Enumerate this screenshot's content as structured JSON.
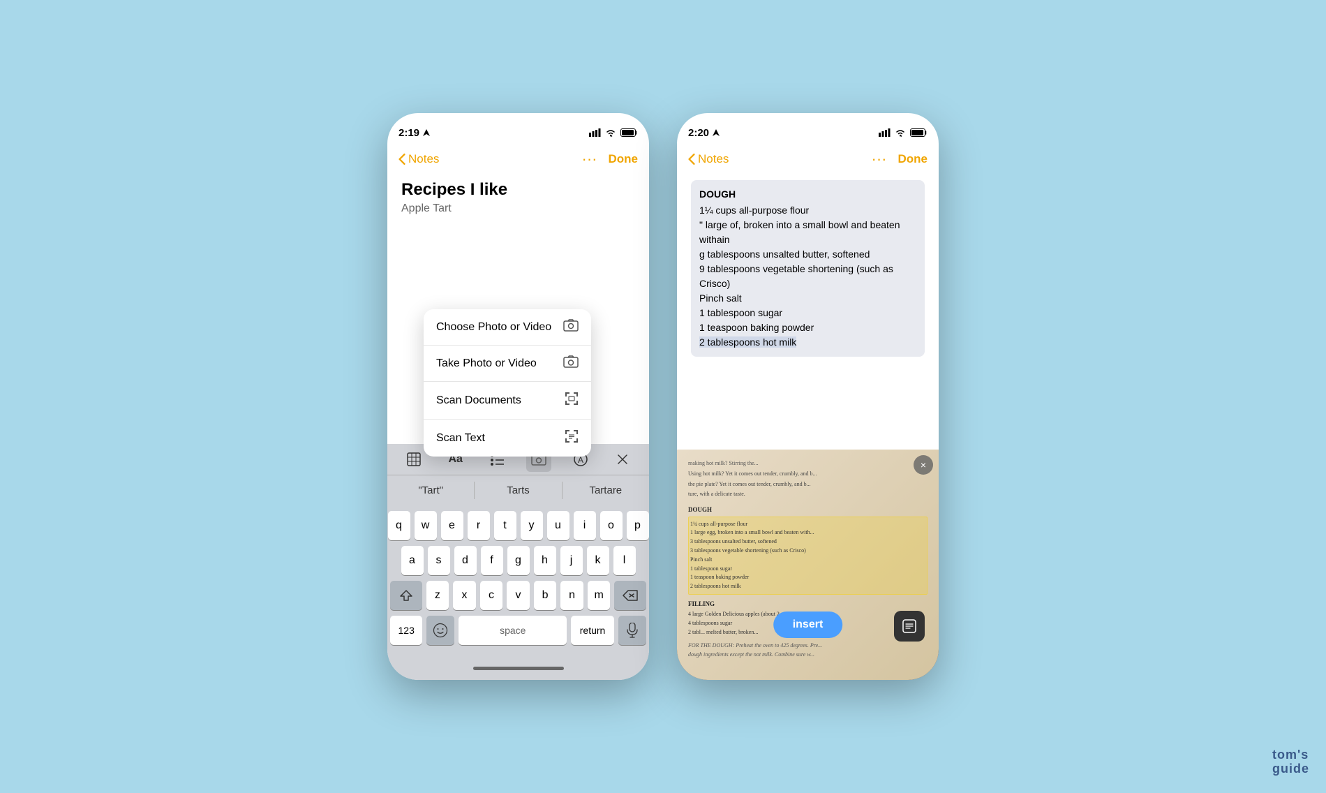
{
  "left_phone": {
    "status_bar": {
      "time": "2:19",
      "signal_bars": "●●●●",
      "wifi": "wifi",
      "battery": "battery"
    },
    "nav": {
      "back_label": "Notes",
      "more_label": "···",
      "done_label": "Done"
    },
    "note": {
      "title": "Recipes I like",
      "subtitle": "Apple Tart"
    },
    "popup_menu": {
      "items": [
        {
          "label": "Choose Photo or Video",
          "icon": "photo"
        },
        {
          "label": "Take Photo or Video",
          "icon": "camera"
        },
        {
          "label": "Scan Documents",
          "icon": "scan-doc"
        },
        {
          "label": "Scan Text",
          "icon": "scan-text"
        }
      ]
    },
    "toolbar": {
      "items": [
        "table",
        "Aa",
        "list",
        "camera",
        "circle-a",
        "close"
      ]
    },
    "autocomplete": {
      "items": [
        "\"Tart\"",
        "Tarts",
        "Tartare"
      ]
    },
    "keyboard": {
      "row1": [
        "q",
        "w",
        "e",
        "r",
        "t",
        "y",
        "u",
        "i",
        "o",
        "p"
      ],
      "row2": [
        "a",
        "s",
        "d",
        "f",
        "g",
        "h",
        "j",
        "k",
        "l"
      ],
      "row3": [
        "z",
        "x",
        "c",
        "v",
        "b",
        "n",
        "m"
      ],
      "bottom": {
        "num_label": "123",
        "space_label": "space",
        "return_label": "return"
      }
    }
  },
  "right_phone": {
    "status_bar": {
      "time": "2:20",
      "signal_bars": "●●●●",
      "wifi": "wifi",
      "battery": "battery"
    },
    "nav": {
      "back_label": "Notes",
      "more_label": "···",
      "done_label": "Done"
    },
    "note_content": {
      "lines": [
        "DOUGH",
        "1¼ cups all-purpose flour",
        "\" large of, broken into a small bowl and beaten withain",
        "g tablespoons unsalted butter, softened",
        "9 tablespoons vegetable shortening (such as Crisco)",
        "Pinch salt",
        "1 tablespoon sugar",
        "1 teaspoon baking powder",
        "2 tablespoons hot milk"
      ],
      "highlighted_end": "2 tablespoons hot milk"
    },
    "toolbar": {
      "items": [
        "table",
        "Aa",
        "list",
        "camera",
        "circle-a",
        "close"
      ]
    },
    "scan_overlay": {
      "lines": [
        "making hot milk? Stirring the...",
        "Using hot milk? Yet it comes out tender, crumbly, and b...",
        "the pie plate? Yet it comes out tender, crumbly, and b...",
        "ture, with a delicate taste.",
        "",
        "DOUGH",
        "1¼ cups all-purpose flour",
        "1 large egg, broken into a small bowl and beaten with...",
        "3 tablespoons unsalted butter, softened",
        "3 tablespoons vegetable shortening (such as Crisco)",
        "Pinch salt",
        "1 tablespoon sugar",
        "1 teaspoon baking powder",
        "2 tablespoons hot milk",
        "",
        "FILLING",
        "4 large Golden Delicious apples (about 2 pounds)",
        "4 tablespoons sugar",
        "2 tabl... melted butter, broken..."
      ],
      "insert_label": "insert",
      "close_label": "×"
    }
  },
  "watermark": "tom's guide"
}
